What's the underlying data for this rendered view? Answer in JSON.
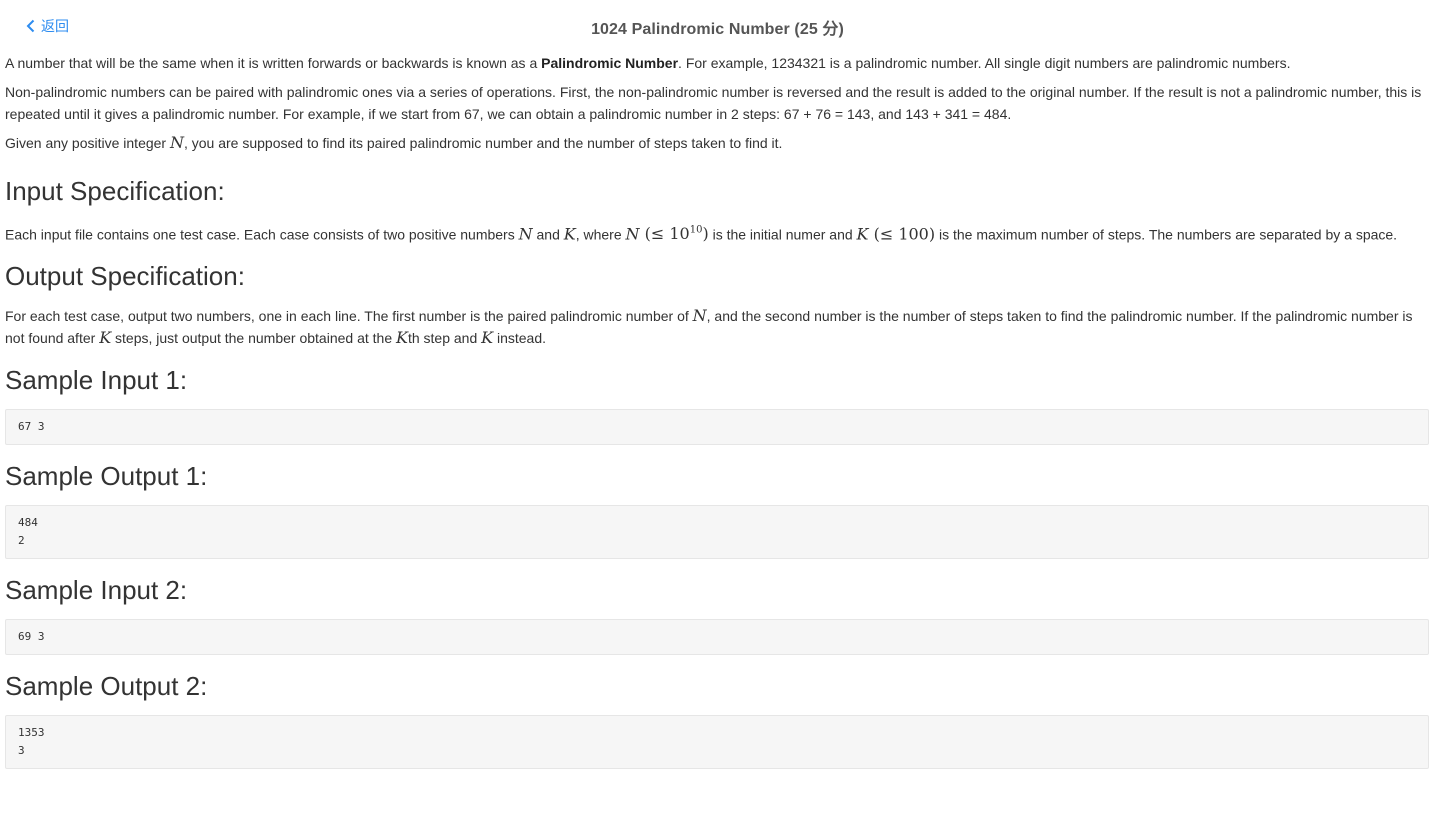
{
  "header": {
    "back_label": "返回",
    "title": "1024 Palindromic Number (25 分)"
  },
  "problem": {
    "p1_before": "A number that will be the same when it is written forwards or backwards is known as a ",
    "p1_bold": "Palindromic Number",
    "p1_after": ". For example, 1234321 is a palindromic number. All single digit numbers are palindromic numbers.",
    "p2": "Non-palindromic numbers can be paired with palindromic ones via a series of operations. First, the non-palindromic number is reversed and the result is added to the original number. If the result is not a palindromic number, this is repeated until it gives a palindromic number. For example, if we start from 67, we can obtain a palindromic number in 2 steps: 67 + 76 = 143, and 143 + 341 = 484.",
    "p3_before": "Given any positive integer ",
    "p3_var": "N",
    "p3_after": ", you are supposed to find its paired palindromic number and the number of steps taken to find it."
  },
  "input_spec": {
    "heading": "Input Specification:",
    "t1": "Each input file contains one test case. Each case consists of two positive numbers ",
    "v_n": "N",
    "t2": " and ",
    "v_k": "K",
    "t3": ", where ",
    "v_n2": "N",
    "m1": " (≤ 10",
    "m1_sup": "10",
    "m1_end": ")",
    "t4": " is the initial numer and ",
    "v_k2": "K",
    "m2": " (≤ 100)",
    "t5": " is the maximum number of steps. The numbers are separated by a space."
  },
  "output_spec": {
    "heading": "Output Specification:",
    "t1": "For each test case, output two numbers, one in each line. The first number is the paired palindromic number of ",
    "v_n": "N",
    "t2": ", and the second number is the number of steps taken to find the palindromic number. If the palindromic number is not found after ",
    "v_k": "K",
    "t3": " steps, just output the number obtained at the ",
    "v_k2": "K",
    "t4": "th step and ",
    "v_k3": "K",
    "t5": " instead."
  },
  "samples": {
    "input1_heading": "Sample Input 1:",
    "input1": "67 3",
    "output1_heading": "Sample Output 1:",
    "output1": "484\n2",
    "input2_heading": "Sample Input 2:",
    "input2": "69 3",
    "output2_heading": "Sample Output 2:",
    "output2": "1353\n3"
  }
}
